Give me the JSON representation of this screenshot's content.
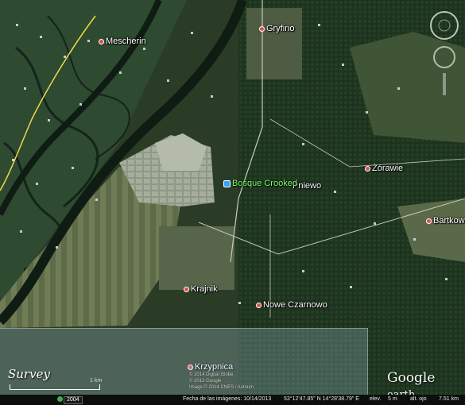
{
  "places": [
    {
      "id": "mescherin",
      "label": "Mescherin"
    },
    {
      "id": "gryfino",
      "label": "Gryfino"
    },
    {
      "id": "zorawie",
      "label": "Żórawie"
    },
    {
      "id": "bartkowo",
      "label": "Bartkowo"
    },
    {
      "id": "krajnik",
      "label": "Krajnik"
    },
    {
      "id": "nowe-czarnowo",
      "label": "Nowe Czarnowo"
    },
    {
      "id": "krzypnica",
      "label": "Krzypnica"
    },
    {
      "id": "pniewo",
      "label": "Pniewo"
    }
  ],
  "poi": {
    "label": "Bosque Crooked"
  },
  "overview": {
    "title": "Survey",
    "scale_label": "1 km"
  },
  "logo": {
    "main": "Google",
    "sub": " earth"
  },
  "status": {
    "year": "2004",
    "date": "Fecha de las imágenes: 10/14/2013",
    "coords": "53°12'47.85\" N   14°28'38.79\" E",
    "elev": "elev.",
    "elev_value": "5 m",
    "alt": "alt. ojo",
    "alt_value": "7.51 km"
  },
  "copyright": [
    "© 2014 Digital Globe",
    "© 2013 Google",
    "Image © 2014 CNES / Astrium"
  ],
  "colors": {
    "water": "#1f3b2a",
    "river": "#0e1a12",
    "forest": "#1f3520",
    "farmland": "#5b6a46",
    "industrial": "#b8bdb4",
    "road_yellow": "#f0d84a"
  }
}
